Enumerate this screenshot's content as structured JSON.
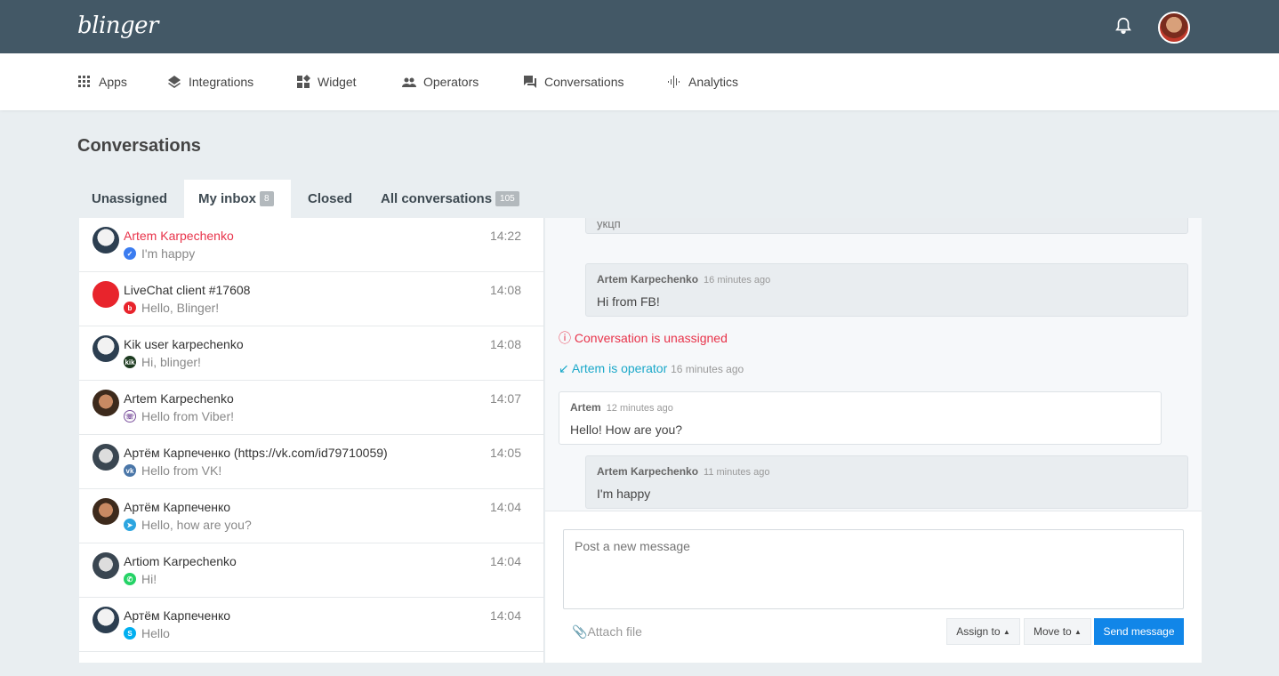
{
  "app": {
    "logo": "blinger"
  },
  "nav": [
    {
      "label": "Apps",
      "icon": "grid-icon"
    },
    {
      "label": "Integrations",
      "icon": "layers-icon"
    },
    {
      "label": "Widget",
      "icon": "widget-icon"
    },
    {
      "label": "Operators",
      "icon": "people-icon"
    },
    {
      "label": "Conversations",
      "icon": "chat-icon"
    },
    {
      "label": "Analytics",
      "icon": "analytics-icon"
    }
  ],
  "page_title": "Conversations",
  "tabs": [
    {
      "label": "Unassigned"
    },
    {
      "label": "My inbox",
      "badge": "8",
      "active": true
    },
    {
      "label": "Closed"
    },
    {
      "label": "All conversations",
      "badge": "105"
    }
  ],
  "conversations": [
    {
      "name": "Artem Karpechenko",
      "preview": "I'm happy",
      "time": "14:22",
      "channel": "messenger",
      "unread": true
    },
    {
      "name": "LiveChat client #17608",
      "preview": "Hello, Blinger!",
      "time": "14:08",
      "channel": "blinger"
    },
    {
      "name": "Kik user karpechenko",
      "preview": "Hi, blinger!",
      "time": "14:08",
      "channel": "kik"
    },
    {
      "name": "Artem Karpechenko",
      "preview": "Hello from Viber!",
      "time": "14:07",
      "channel": "viber"
    },
    {
      "name": "Артём Карпеченко (https://vk.com/id79710059)",
      "preview": "Hello from VK!",
      "time": "14:05",
      "channel": "vk"
    },
    {
      "name": "Артём Карпеченко",
      "preview": "Hello, how are you?",
      "time": "14:04",
      "channel": "telegram"
    },
    {
      "name": "Artiom Karpechenko",
      "preview": "Hi!",
      "time": "14:04",
      "channel": "whatsapp"
    },
    {
      "name": "Артём Карпеченко",
      "preview": "Hello",
      "time": "14:04",
      "channel": "skype"
    }
  ],
  "chat": {
    "partial_message": "укцп",
    "messages": [
      {
        "author": "Artem Karpechenko",
        "ago": "16 minutes ago",
        "text": "Hi from FB!"
      },
      {
        "author": "Artem",
        "ago": "12 minutes ago",
        "text": "Hello! How are you?"
      },
      {
        "author": "Artem Karpechenko",
        "ago": "11 minutes ago",
        "text": "I'm happy"
      }
    ],
    "unassigned_notice": "Conversation is unassigned",
    "operator_notice": "Artem is operator",
    "operator_ago": "16 minutes ago"
  },
  "composer": {
    "placeholder": "Post a new message",
    "attach": "Attach file",
    "assign": "Assign to",
    "move": "Move to",
    "send": "Send message"
  },
  "colors": {
    "header": "#435866",
    "accent": "#1186e8",
    "alert": "#e8334a",
    "info": "#1aa8c9"
  }
}
